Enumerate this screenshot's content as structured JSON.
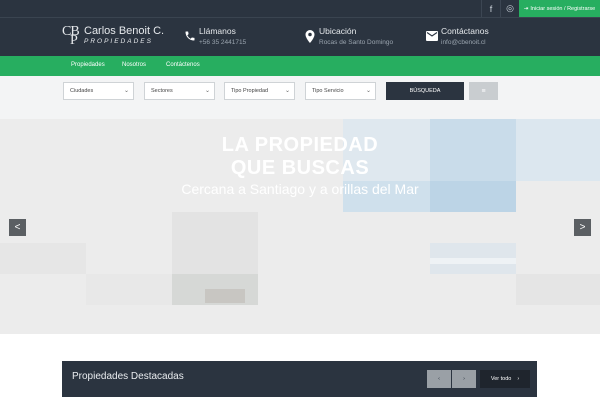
{
  "topbar": {
    "facebook_icon": "f",
    "instagram_icon": "◎",
    "login_label": "Iniciar sesión / Registrarse"
  },
  "logo": {
    "mono_top": "CB",
    "mono_bottom": "P",
    "name": "Carlos Benoit C.",
    "sub": "PROPIEDADES"
  },
  "contact": [
    {
      "title": "Llámanos",
      "detail": "+56 35 2441715",
      "icon": "phone-icon"
    },
    {
      "title": "Ubicación",
      "detail": "Rocas de Santo Domingo",
      "icon": "location-icon"
    },
    {
      "title": "Contáctanos",
      "detail": "info@cbenoit.cl",
      "icon": "mail-icon"
    }
  ],
  "nav": [
    "Propiedades",
    "Nosotros",
    "Contáctenos"
  ],
  "search": {
    "selects": [
      "Ciudades",
      "Sectores",
      "Tipo Propiedad",
      "Tipo Servicio"
    ],
    "button": "BÚSQUEDA",
    "grid_icon": "≡"
  },
  "hero": {
    "line1": "LA PROPIEDAD",
    "line2": "QUE BUSCAS",
    "line3": "Cercana a Santiago y a orillas del Mar",
    "prev": "<",
    "next": ">"
  },
  "featured": {
    "title": "Propiedades Destacadas",
    "prev": "‹",
    "next": "›",
    "view_all": "Ver todo",
    "view_all_arrow": "›"
  }
}
